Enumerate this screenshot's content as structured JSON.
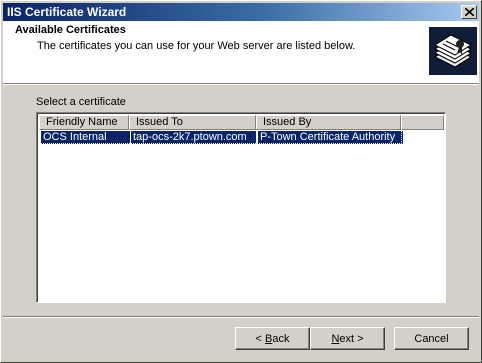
{
  "window": {
    "title": "IIS Certificate Wizard",
    "close_glyph": "×"
  },
  "header": {
    "heading": "Available Certificates",
    "subheading": "The certificates you can use for your Web server are listed below.",
    "art_icon": "certificate-stack-icon"
  },
  "main": {
    "list_label": "Select a certificate",
    "columns": [
      "Friendly Name",
      "Issued To",
      "Issued By"
    ],
    "rows": [
      {
        "friendly_name": "OCS Internal",
        "issued_to": "tap-ocs-2k7.ptown.com",
        "issued_by": "P-Town Certificate Authority",
        "selected": true
      }
    ]
  },
  "buttons": {
    "back_accel": "B",
    "back_rest": "ack",
    "back_prefix": "< ",
    "next_accel": "N",
    "next_rest": "ext >",
    "cancel": "Cancel"
  },
  "colors": {
    "title_active": "#0a246a",
    "selection": "#0a246a",
    "face": "#d4d0c8"
  }
}
